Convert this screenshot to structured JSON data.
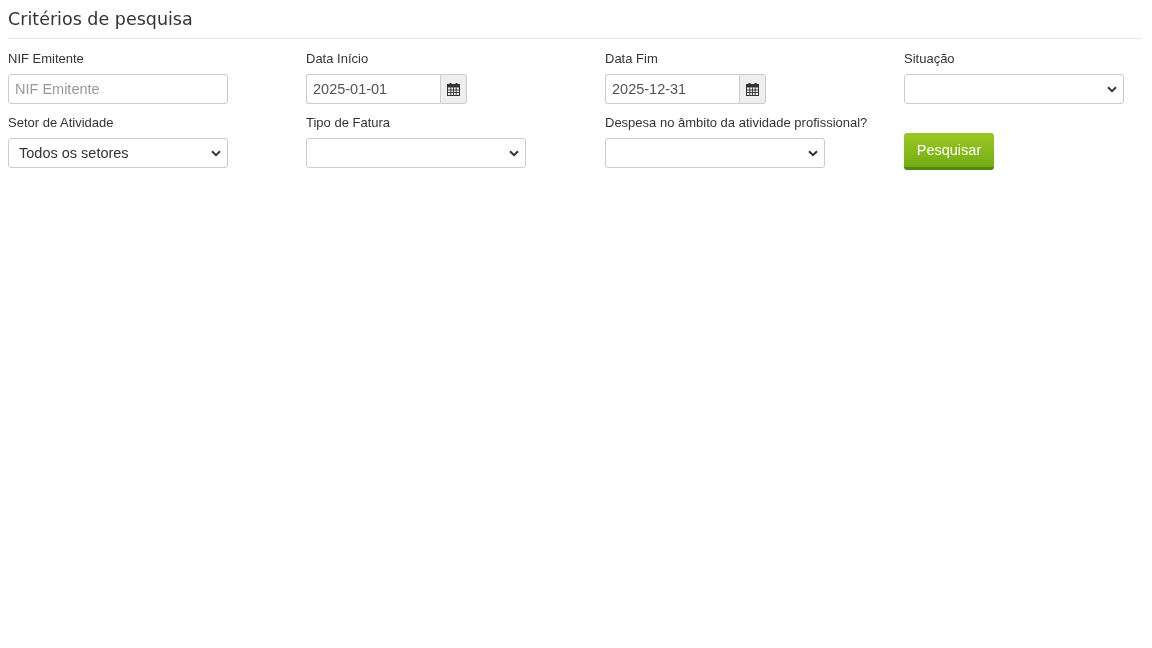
{
  "section": {
    "title": "Critérios de pesquisa"
  },
  "fields": [
    {
      "kind": "text",
      "label": "NIF Emitente",
      "placeholder": "NIF Emitente"
    },
    {
      "kind": "date",
      "label": "Data Início",
      "value": "2025-01-01"
    },
    {
      "kind": "date",
      "label": "Data Fim",
      "value": "2025-12-31"
    },
    {
      "kind": "select",
      "label": "Situação"
    },
    {
      "kind": "select",
      "label": "Setor de Atividade",
      "value": "Todos os setores"
    },
    {
      "kind": "select",
      "label": "Tipo de Fatura"
    },
    {
      "kind": "select",
      "label": "Despesa no âmbito da atividade profissional?"
    }
  ],
  "search_button": {
    "label": "Pesquisar"
  }
}
